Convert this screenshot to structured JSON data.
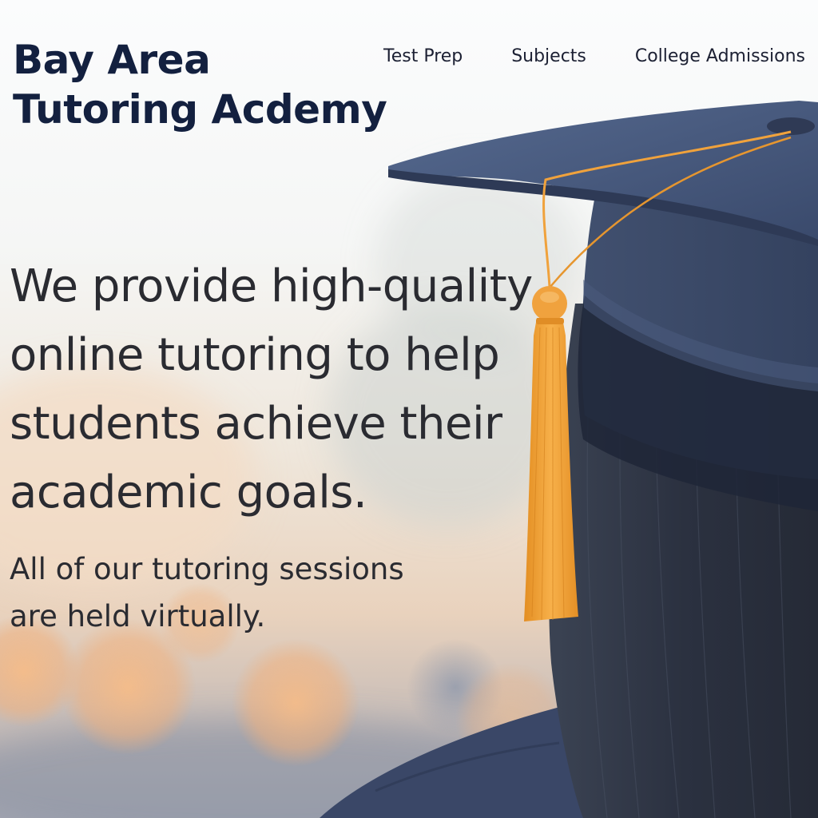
{
  "brand": {
    "line1": "Bay Area",
    "line2": "Tutoring Acdemy"
  },
  "nav": {
    "items": [
      "Test Prep",
      "Subjects",
      "College Admissions"
    ]
  },
  "hero": {
    "headline": "We provide high-quality online tutoring to help students achieve their academic goals.",
    "subtext": "All of our tutoring sessions are held virtually."
  },
  "colors": {
    "brand_text": "#13203f",
    "body_text": "#2a2b31",
    "cap": "#3e4d6c",
    "tassel": "#f3a53a",
    "bokeh": "#f2b482"
  },
  "icons": [
    "graduation-cap-image",
    "tassel-image"
  ]
}
